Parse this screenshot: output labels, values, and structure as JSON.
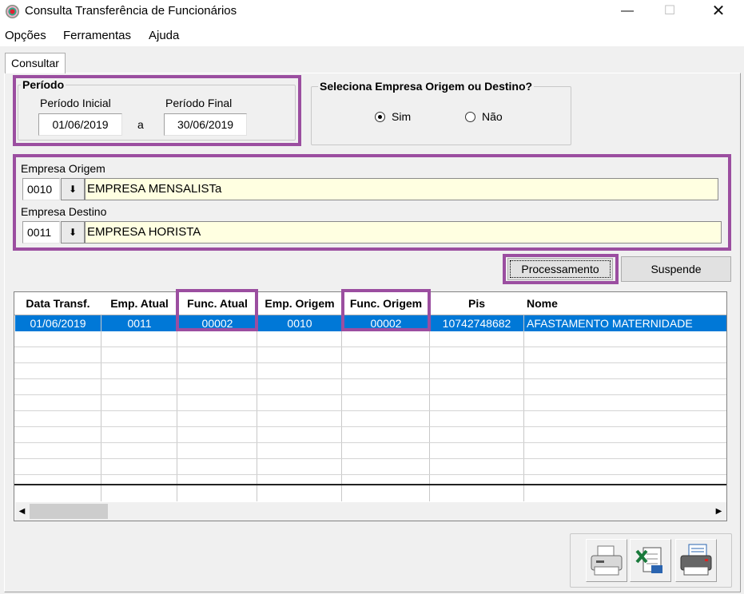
{
  "window": {
    "title": "Consulta Transferência de Funcionários",
    "min_glyph": "—",
    "max_glyph": "☐",
    "close_glyph": "✕"
  },
  "menu": [
    "Opções",
    "Ferramentas",
    "Ajuda"
  ],
  "tab": {
    "label": "Consultar"
  },
  "periodo": {
    "legend": "Período",
    "inicial_label": "Período Inicial",
    "inicial_value": "01/06/2019",
    "separator": "a",
    "final_label": "Período Final",
    "final_value": "30/06/2019"
  },
  "seleciona": {
    "legend": "Seleciona Empresa Origem ou Destino?",
    "options": [
      {
        "label": "Sim",
        "selected": true
      },
      {
        "label": "Não",
        "selected": false
      }
    ]
  },
  "empresa_origem": {
    "label": "Empresa Origem",
    "code": "0010",
    "dropdown_glyph": "⬇",
    "name": "EMPRESA MENSALISTa"
  },
  "empresa_destino": {
    "label": "Empresa Destino",
    "code": "0011",
    "dropdown_glyph": "⬇",
    "name": "EMPRESA HORISTA"
  },
  "buttons": {
    "processamento": "Processamento",
    "suspende": "Suspende"
  },
  "grid": {
    "columns": [
      "Data Transf.",
      "Emp. Atual",
      "Func. Atual",
      "Emp. Origem",
      "Func. Origem",
      "Pis",
      "Nome"
    ],
    "rows": [
      [
        "01/06/2019",
        "0011",
        "00002",
        "0010",
        "00002",
        "10742748682",
        "AFASTAMENTO MATERNIDADE"
      ]
    ],
    "selected_row": 0
  },
  "scrollbar": {
    "left_glyph": "◀",
    "right_glyph": "▶"
  },
  "icons": [
    "printer-icon",
    "excel-icon",
    "print-preview-icon"
  ],
  "colors": {
    "highlight": "#9b4ea0",
    "selection": "#0078d7",
    "field_yellow": "#ffffe1"
  }
}
